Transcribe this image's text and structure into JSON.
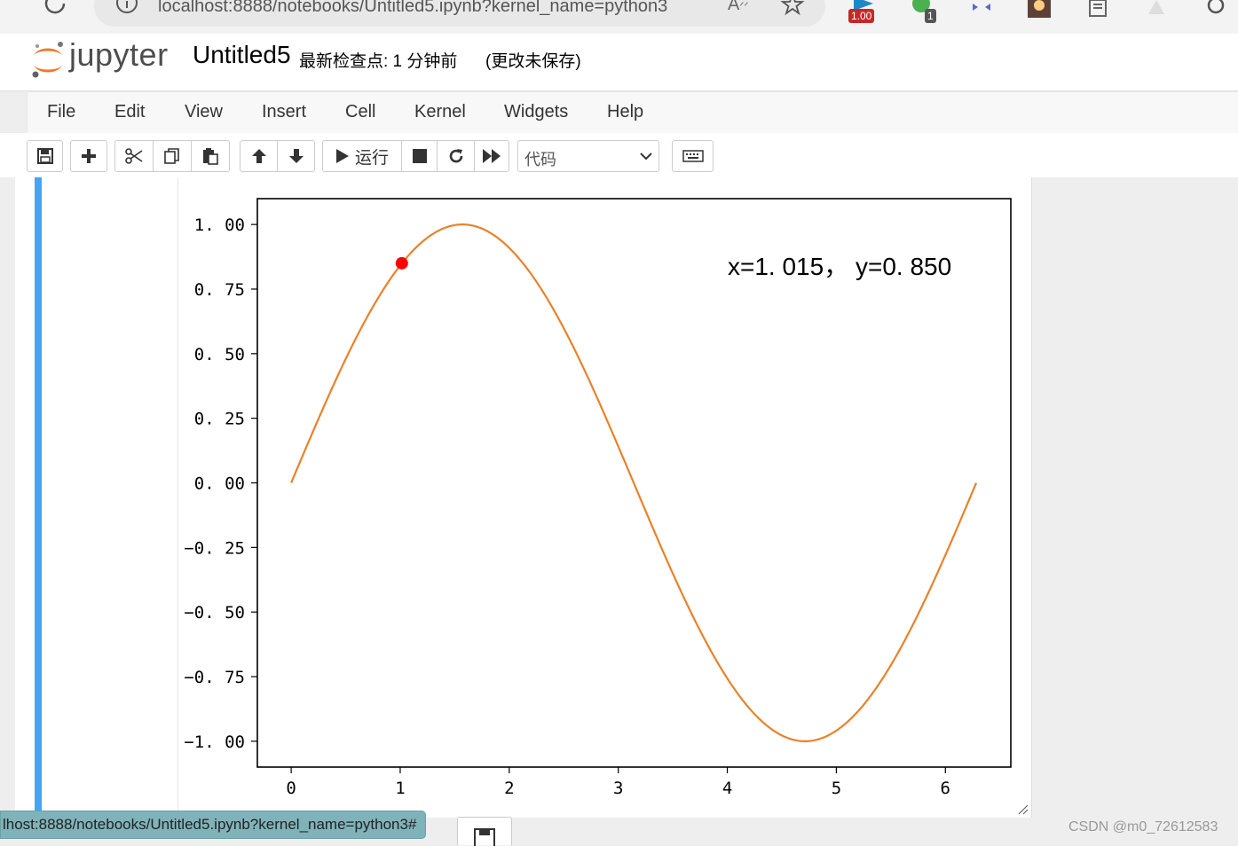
{
  "browser": {
    "address": "localhost:8888/notebooks/Untitled5.ipynb?kernel_name=python3",
    "extension_badges": [
      "1.00",
      "1"
    ]
  },
  "header": {
    "logo_text": "jupyter",
    "notebook_name": "Untitled5",
    "checkpoint": "最新检查点: 1 分钟前",
    "autosave": "(更改未保存)"
  },
  "menu": {
    "items": [
      "File",
      "Edit",
      "View",
      "Insert",
      "Cell",
      "Kernel",
      "Widgets",
      "Help"
    ]
  },
  "toolbar": {
    "run_label": "运行",
    "cell_type": "代码",
    "icons": [
      "save-icon",
      "plus-icon",
      "cut-icon",
      "copy-icon",
      "paste-icon",
      "arrow-up-icon",
      "arrow-down-icon",
      "play-icon",
      "stop-icon",
      "restart-icon",
      "fast-forward-icon",
      "keyboard-icon"
    ]
  },
  "status": {
    "link_preview": "lhost:8888/notebooks/Untitled5.ipynb?kernel_name=python3#",
    "watermark": "CSDN @m0_72612583"
  },
  "colors": {
    "line": "#e8822a",
    "marker": "#ff0000",
    "cell_selected_bar": "#42a5f5"
  },
  "chart_data": {
    "type": "line",
    "function": "sin",
    "x_range": [
      0,
      6.283
    ],
    "xlim": [
      -0.31,
      6.6
    ],
    "ylim": [
      -1.1,
      1.1
    ],
    "xticks": [
      0,
      1,
      2,
      3,
      4,
      5,
      6
    ],
    "yticks": [
      1.0,
      0.75,
      0.5,
      0.25,
      0.0,
      -0.25,
      -0.5,
      -0.75,
      -1.0
    ],
    "ytick_labels": [
      "1. 00",
      "0. 75",
      "0. 50",
      "0. 25",
      "0. 00",
      "−0. 25",
      "−0. 50",
      "−0. 75",
      "−1. 00"
    ],
    "xtick_labels": [
      "0",
      "1",
      "2",
      "3",
      "4",
      "5",
      "6"
    ],
    "marker_point": {
      "x": 1.015,
      "y": 0.85
    },
    "annotation": "x=1. 015，  y=0. 850",
    "grid": false
  }
}
